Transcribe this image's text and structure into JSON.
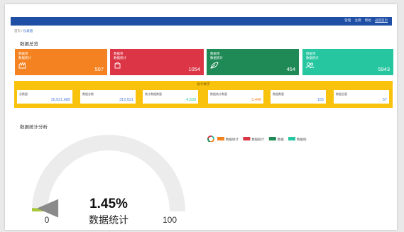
{
  "topbar": {
    "links": [
      "管理",
      "注销",
      "帮助",
      "返回首页"
    ]
  },
  "breadcrumb": {
    "home": "首页",
    "separator": "/",
    "current": "仪表盘"
  },
  "section1": {
    "title": "数据总览"
  },
  "cards": [
    {
      "line1": "数据项",
      "line2": "数据统计",
      "value": "507",
      "color": "#f58220",
      "icon": "hand-icon"
    },
    {
      "line1": "数据项",
      "line2": "数据统计",
      "value": "1054",
      "color": "#dc3545",
      "icon": "box-icon"
    },
    {
      "line1": "数据项",
      "line2": "数据统计",
      "value": "454",
      "color": "#1f8a55",
      "icon": "leaf-icon"
    },
    {
      "line1": "数据项",
      "line2": "数据统计",
      "value": "5943",
      "color": "#26c6a0",
      "icon": "users-icon"
    }
  ],
  "stats": {
    "title": "统计数字",
    "items": [
      {
        "label": "总数量",
        "value": "16,521,689",
        "color": "#4a7cd8"
      },
      {
        "label": "数据总数",
        "value": "312,021",
        "color": "#4a7cd8"
      },
      {
        "label": "统计数据数量",
        "value": "4,539",
        "color": "#26c6a0"
      },
      {
        "label": "数据统计数量",
        "value": "3,440",
        "color": "#f58220"
      },
      {
        "label": "数据数量",
        "value": "155",
        "color": "#4a7cd8"
      },
      {
        "label": "数据总量",
        "value": "57",
        "color": "#4a7cd8"
      }
    ]
  },
  "section2": {
    "title": "数据统计分析"
  },
  "legend": [
    {
      "label": "数据统计",
      "color": "#f58220"
    },
    {
      "label": "数据统计",
      "color": "#dc3545"
    },
    {
      "label": "数据",
      "color": "#1f8a55"
    },
    {
      "label": "数据统计",
      "color": "#26c6a0"
    }
  ],
  "gauge": {
    "value_text": "1.45%",
    "value": 1.45,
    "min": "0",
    "max": "100",
    "label": "数据统计"
  }
}
